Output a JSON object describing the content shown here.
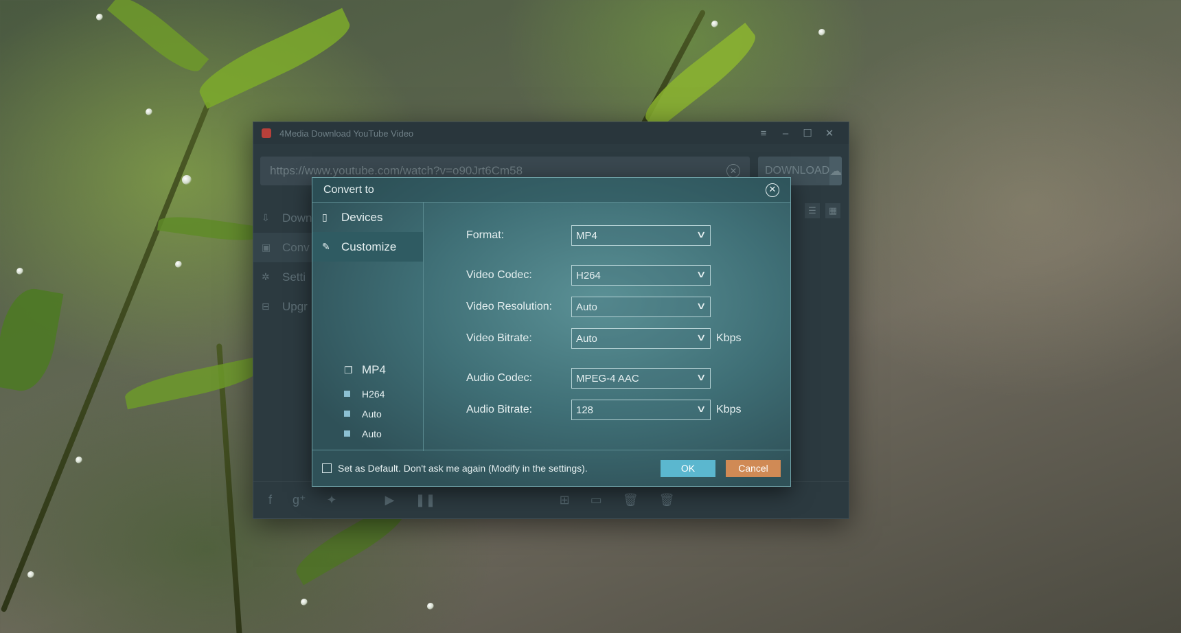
{
  "app": {
    "title": "4Media Download YouTube Video",
    "url_value": "https://www.youtube.com/watch?v=o90Jrt6Cm58",
    "download_label": "DOWNLOAD",
    "sidebar": [
      {
        "label": "Down",
        "icon": "download-icon"
      },
      {
        "label": "Conv",
        "icon": "convert-icon"
      },
      {
        "label": "Setti",
        "icon": "gear-icon"
      },
      {
        "label": "Upgr",
        "icon": "cart-icon"
      }
    ]
  },
  "dialog": {
    "title": "Convert to",
    "categories": [
      {
        "label": "Devices",
        "icon": "devices-icon"
      },
      {
        "label": "Customize",
        "icon": "customize-icon"
      }
    ],
    "summary": {
      "title": "MP4",
      "items": [
        "H264",
        "Auto",
        "Auto"
      ],
      "bullet_color": "#8cc0d2"
    },
    "fields": {
      "format": {
        "label": "Format:",
        "value": "MP4"
      },
      "video_codec": {
        "label": "Video Codec:",
        "value": "H264"
      },
      "video_resolution": {
        "label": "Video Resolution:",
        "value": "Auto"
      },
      "video_bitrate": {
        "label": "Video Bitrate:",
        "value": "Auto",
        "unit": "Kbps"
      },
      "audio_codec": {
        "label": "Audio Codec:",
        "value": "MPEG-4 AAC"
      },
      "audio_bitrate": {
        "label": "Audio Bitrate:",
        "value": "128",
        "unit": "Kbps"
      }
    },
    "footer": {
      "default_text": "Set as Default. Don't ask me again (Modify in the settings).",
      "ok_label": "OK",
      "cancel_label": "Cancel"
    },
    "colors": {
      "ok": "#5bb7cf",
      "cancel": "#d08a55"
    }
  }
}
